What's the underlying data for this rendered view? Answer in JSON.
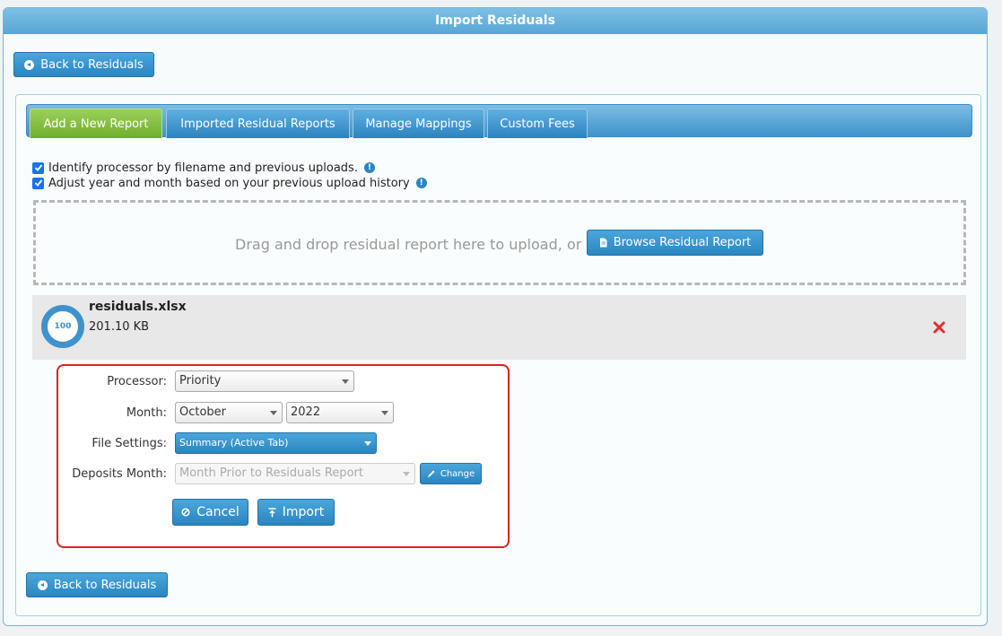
{
  "header": {
    "title": "Import Residuals"
  },
  "nav": {
    "back_label": "Back to Residuals"
  },
  "tabs": [
    {
      "label": "Add a New Report"
    },
    {
      "label": "Imported Residual Reports"
    },
    {
      "label": "Manage Mappings"
    },
    {
      "label": "Custom Fees"
    }
  ],
  "options": {
    "identify_processor": {
      "label": "Identify processor by filename and previous uploads.",
      "checked": true
    },
    "adjust_date": {
      "label": "Adjust year and month based on your previous upload history",
      "checked": true
    }
  },
  "dropzone": {
    "text": "Drag and drop residual report here to upload, or",
    "browse_label": "Browse Residual Report"
  },
  "file": {
    "name": "residuals.xlsx",
    "size": "201.10 KB",
    "progress": 100
  },
  "form": {
    "processor": {
      "label": "Processor:",
      "value": "Priority"
    },
    "month": {
      "label": "Month:",
      "month_value": "October",
      "year_value": "2022"
    },
    "file_settings": {
      "label": "File Settings:",
      "value": "Summary (Active Tab)"
    },
    "deposits_month": {
      "label": "Deposits Month:",
      "value": "Month Prior to Residuals Report",
      "change_label": "Change"
    },
    "cancel_label": "Cancel",
    "import_label": "Import"
  },
  "colors": {
    "accent_blue": "#2a86c2",
    "active_tab_green": "#6fae2d",
    "highlight_red": "#e02020",
    "remove_red": "#e03030"
  }
}
